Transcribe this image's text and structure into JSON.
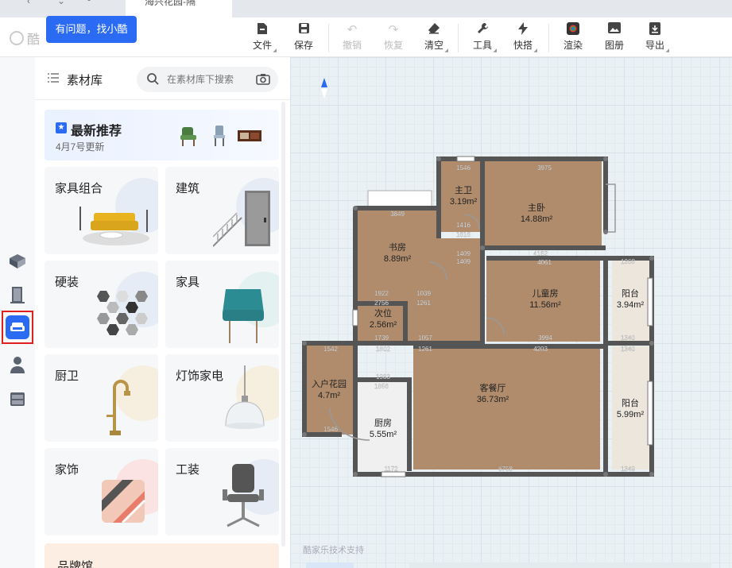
{
  "tab": {
    "title": "海兴花园-隔",
    "close": "×"
  },
  "header": {
    "logo_text": "酷",
    "help_tip": "有问题，找小酷"
  },
  "toolbar": {
    "file": "文件",
    "save": "保存",
    "undo": "撤销",
    "redo": "恢复",
    "clear": "清空",
    "tools": "工具",
    "quick": "快搭",
    "render": "渲染",
    "album": "图册",
    "export": "导出"
  },
  "panel": {
    "title": "素材库",
    "search_placeholder": "在素材库下搜索",
    "recommend_title": "最新推荐",
    "recommend_sub": "4月7号更新",
    "categories": [
      "家具组合",
      "建筑",
      "硬装",
      "家具",
      "厨卫",
      "灯饰家电",
      "家饰",
      "工装"
    ],
    "brand": "品牌馆"
  },
  "canvas": {
    "footer": "酷家乐技术支持"
  },
  "floorplan": {
    "rooms": [
      {
        "name": "主卫",
        "area": "3.19m²"
      },
      {
        "name": "主卧",
        "area": "14.88m²"
      },
      {
        "name": "书房",
        "area": "8.89m²"
      },
      {
        "name": "儿童房",
        "area": "11.56m²"
      },
      {
        "name": "阳台",
        "area": "3.94m²"
      },
      {
        "name": "次位",
        "area": "2.56m²"
      },
      {
        "name": "入户花园",
        "area": "4.7m²"
      },
      {
        "name": "客餐厅",
        "area": "36.73m²"
      },
      {
        "name": "厨房",
        "area": "5.55m²"
      },
      {
        "name": "阳台",
        "area": "5.99m²"
      }
    ],
    "dims": [
      "1546",
      "3975",
      "3849",
      "1416",
      "1616",
      "1409",
      "1409",
      "4162",
      "4061",
      "1368",
      "1922",
      "2756",
      "1039",
      "1261",
      "1739",
      "1057",
      "1261",
      "3994",
      "4203",
      "1340",
      "1340",
      "1542",
      "1802",
      "1983",
      "1856",
      "1546",
      "1172",
      "6758",
      "1349"
    ]
  }
}
